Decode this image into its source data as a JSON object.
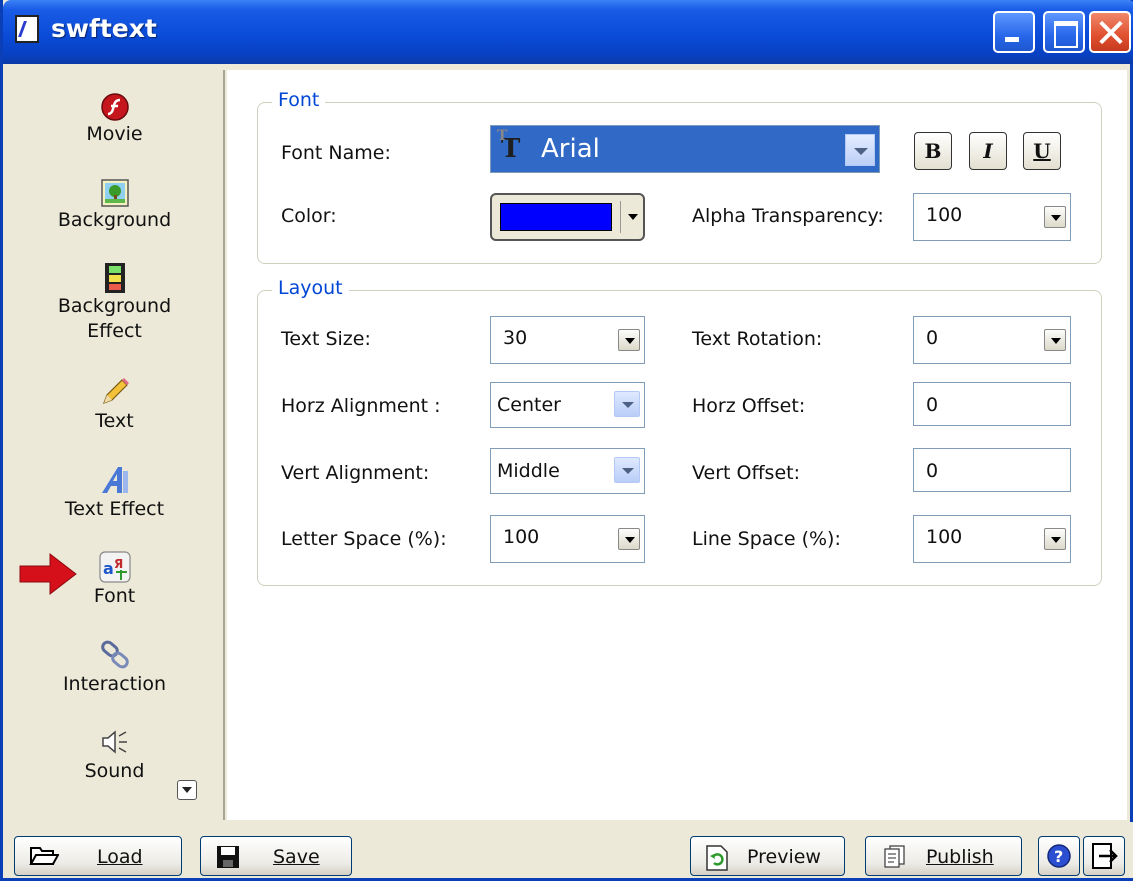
{
  "window": {
    "title": "swftext"
  },
  "sidebar": {
    "items": [
      {
        "label": "Movie",
        "icon": "flash-movie-icon"
      },
      {
        "label": "Background",
        "icon": "background-picture-icon"
      },
      {
        "label": "Background Effect",
        "icon": "film-strip-icon"
      },
      {
        "label": "Text",
        "icon": "pencil-icon"
      },
      {
        "label": "Text Effect",
        "icon": "text-effect-icon"
      },
      {
        "label": "Font",
        "icon": "font-icon",
        "selected": true
      },
      {
        "label": "Interaction",
        "icon": "link-chain-icon"
      },
      {
        "label": "Sound",
        "icon": "speaker-icon"
      }
    ]
  },
  "font_group": {
    "title": "Font",
    "font_name_label": "Font Name:",
    "font_name_value": "Arial",
    "bold_label": "B",
    "italic_label": "I",
    "underline_label": "U",
    "color_label": "Color:",
    "color_value": "#0000ff",
    "alpha_label": "Alpha Transparency:",
    "alpha_value": "100"
  },
  "layout_group": {
    "title": "Layout",
    "text_size_label": "Text Size:",
    "text_size_value": "30",
    "text_rotation_label": "Text Rotation:",
    "text_rotation_value": "0",
    "horz_alignment_label": "Horz Alignment :",
    "horz_alignment_value": "Center",
    "horz_offset_label": "Horz Offset:",
    "horz_offset_value": "0",
    "vert_alignment_label": "Vert Alignment:",
    "vert_alignment_value": "Middle",
    "vert_offset_label": "Vert Offset:",
    "vert_offset_value": "0",
    "letter_space_label": "Letter Space (%):",
    "letter_space_value": "100",
    "line_space_label": "Line Space (%):",
    "line_space_value": "100"
  },
  "footer": {
    "load_label": "Load",
    "save_label": "Save",
    "preview_label": "Preview",
    "publish_label": "Publish"
  }
}
